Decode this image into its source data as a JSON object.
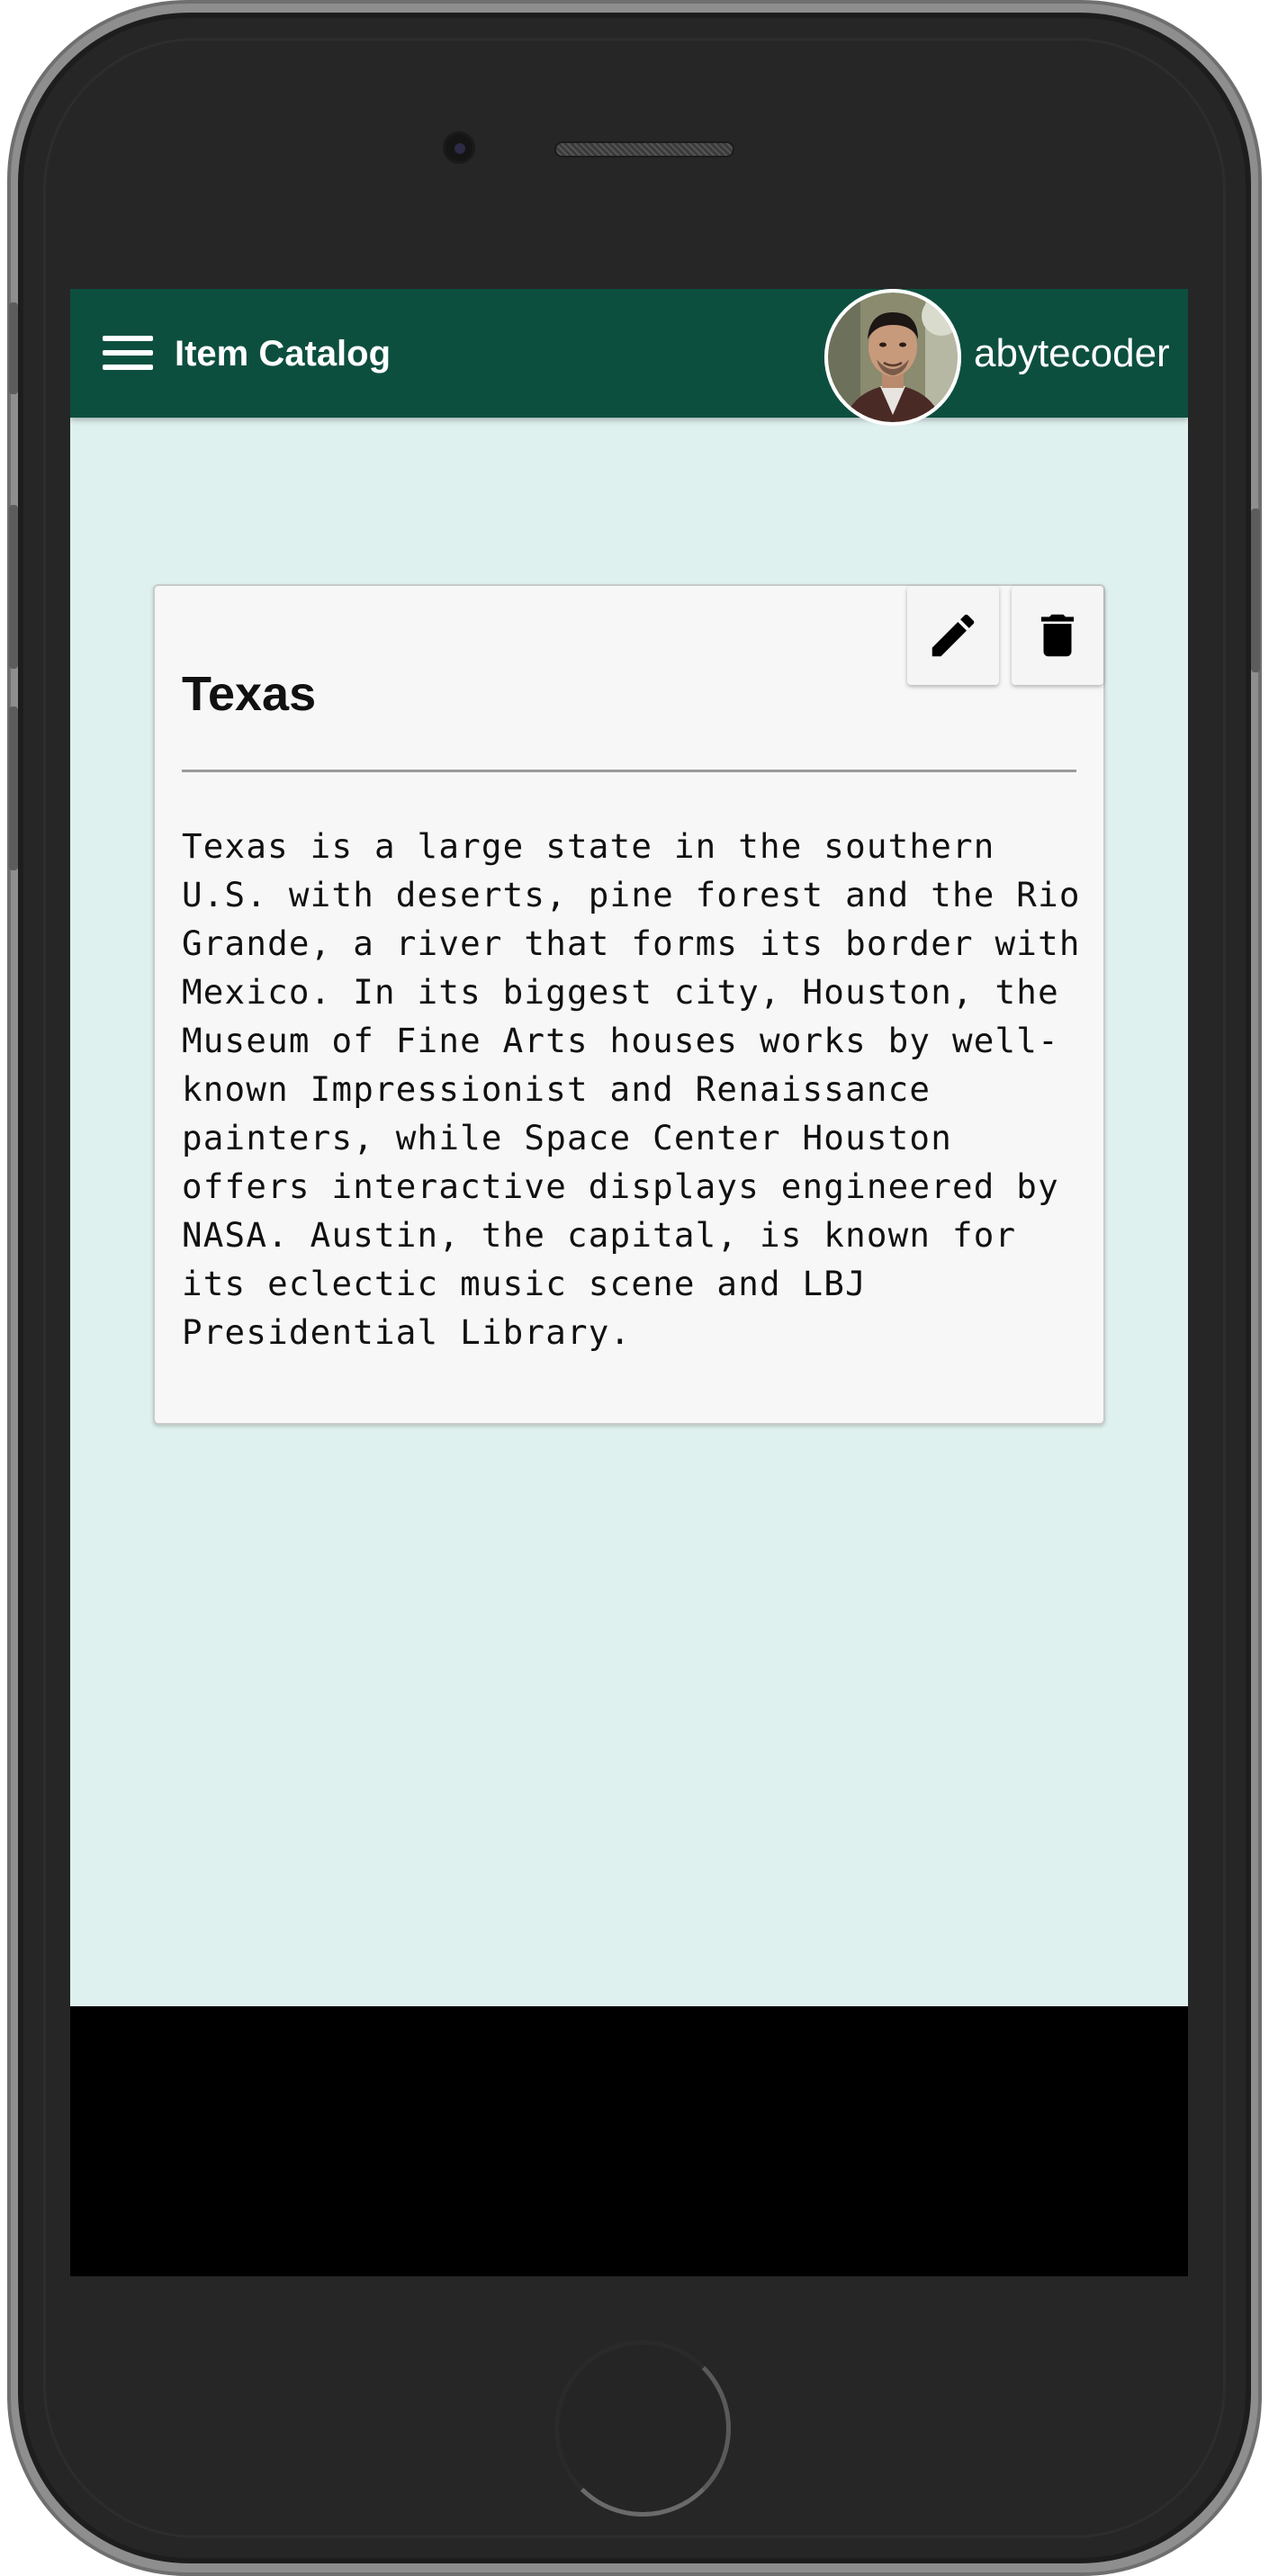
{
  "app": {
    "title": "Item Catalog",
    "username": "abytecoder",
    "theme_color": "#0d4f3f",
    "background_color": "#dff1ee"
  },
  "item": {
    "title": "Texas",
    "description": "Texas is a large state in the southern\nU.S. with deserts, pine forest and the Rio\nGrande, a river that forms its border with\nMexico. In its biggest city, Houston, the\nMuseum of Fine Arts houses works by well-\nknown Impressionist and Renaissance\npainters, while Space Center Houston\noffers interactive displays engineered by\nNASA. Austin, the capital, is known for\nits eclectic music scene and LBJ\nPresidential Library."
  },
  "icons": {
    "menu": "menu-icon",
    "edit": "pencil-icon",
    "delete": "trash-icon",
    "avatar": "user-avatar"
  }
}
